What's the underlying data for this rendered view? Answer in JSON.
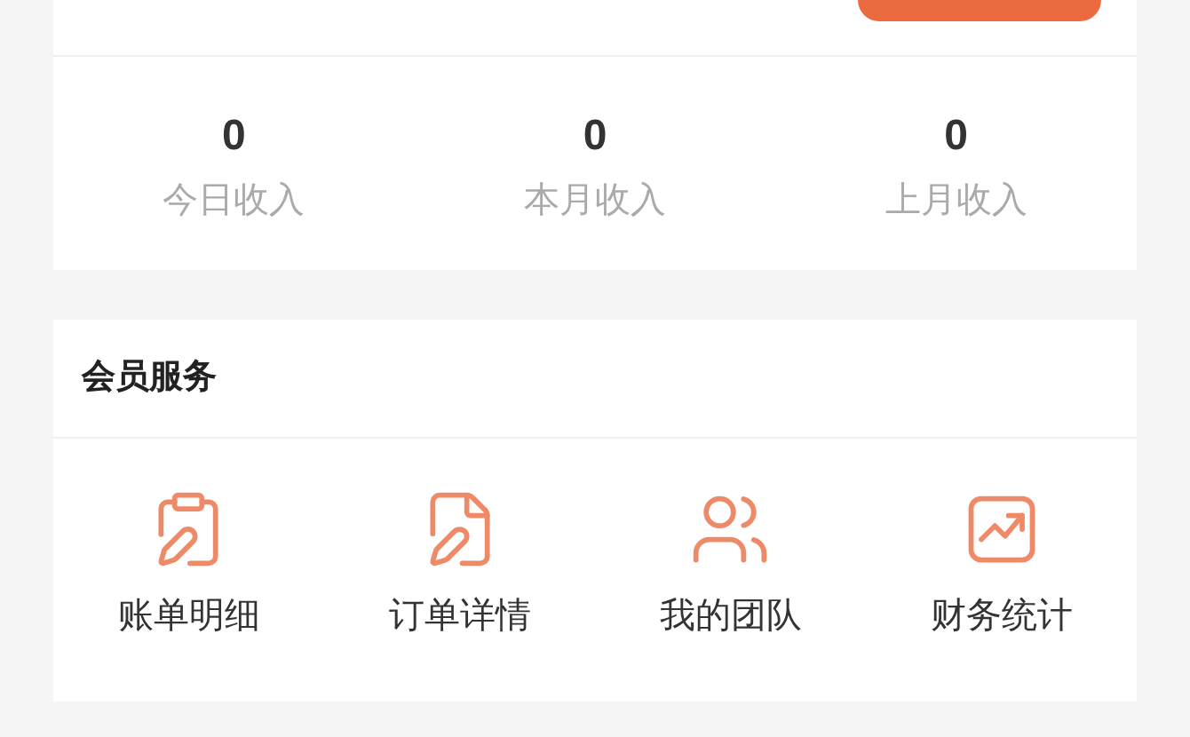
{
  "stats": [
    {
      "value": "0",
      "label": "今日收入"
    },
    {
      "value": "0",
      "label": "本月收入"
    },
    {
      "value": "0",
      "label": "上月收入"
    }
  ],
  "member_services": {
    "title": "会员服务",
    "items": [
      {
        "label": "账单明细"
      },
      {
        "label": "订单详情"
      },
      {
        "label": "我的团队"
      },
      {
        "label": "财务统计"
      }
    ]
  }
}
